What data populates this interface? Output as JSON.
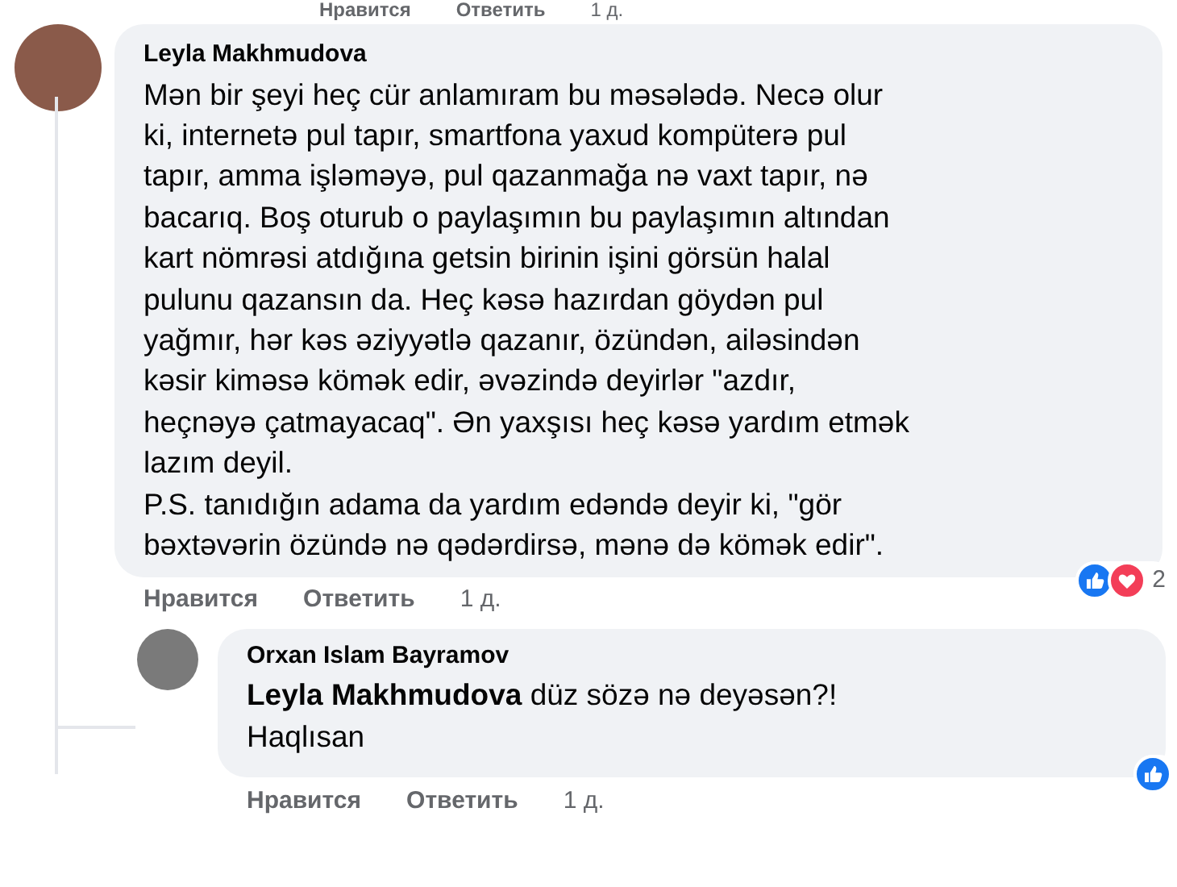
{
  "top_actions": {
    "like": "Нравится",
    "reply": "Ответить",
    "time": "1 д."
  },
  "comments": [
    {
      "author": "Leyla Makhmudova",
      "paragraphs": [
        "Mən bir şeyi heç cür anlamıram bu məsələdə. Necə olur\nki, internetə pul tapır, smartfona yaxud kompüterə pul\ntapır, amma işləməyə, pul qazanmağa nə vaxt tapır, nə\nbacarıq. Boş oturub o paylaşımın bu paylaşımın altından\nkart nömrəsi atdığına getsin birinin işini görsün halal\npulunu qazansın da. Heç kəsə hazırdan göydən pul\nyağmır, hər kəs əziyyətlə qazanır, özündən, ailəsindən\nkəsir kiməsə kömək edir, əvəzində deyirlər \"azdır,\nheçnəyə çatmayacaq\". Ən yaxşısı heç kəsə yardım etmək\nlazım deyil.",
        "P.S. tanıdığın adama da yardım edəndə deyir ki, \"gör\nbəxtəvərin özündə nə qədərdirsə, mənə də kömək edir\"."
      ],
      "reactions": {
        "like": true,
        "love": true,
        "count": "2"
      },
      "actions": {
        "like": "Нравится",
        "reply": "Ответить",
        "time": "1 д."
      }
    },
    {
      "author": "Orxan Islam Bayramov",
      "mention": "Leyla Makhmudova",
      "paragraphs": [
        "düz sözə nə deyəsən?!",
        "Haqlısan"
      ],
      "reactions": {
        "like": true
      },
      "actions": {
        "like": "Нравится",
        "reply": "Ответить",
        "time": "1 д."
      }
    }
  ]
}
